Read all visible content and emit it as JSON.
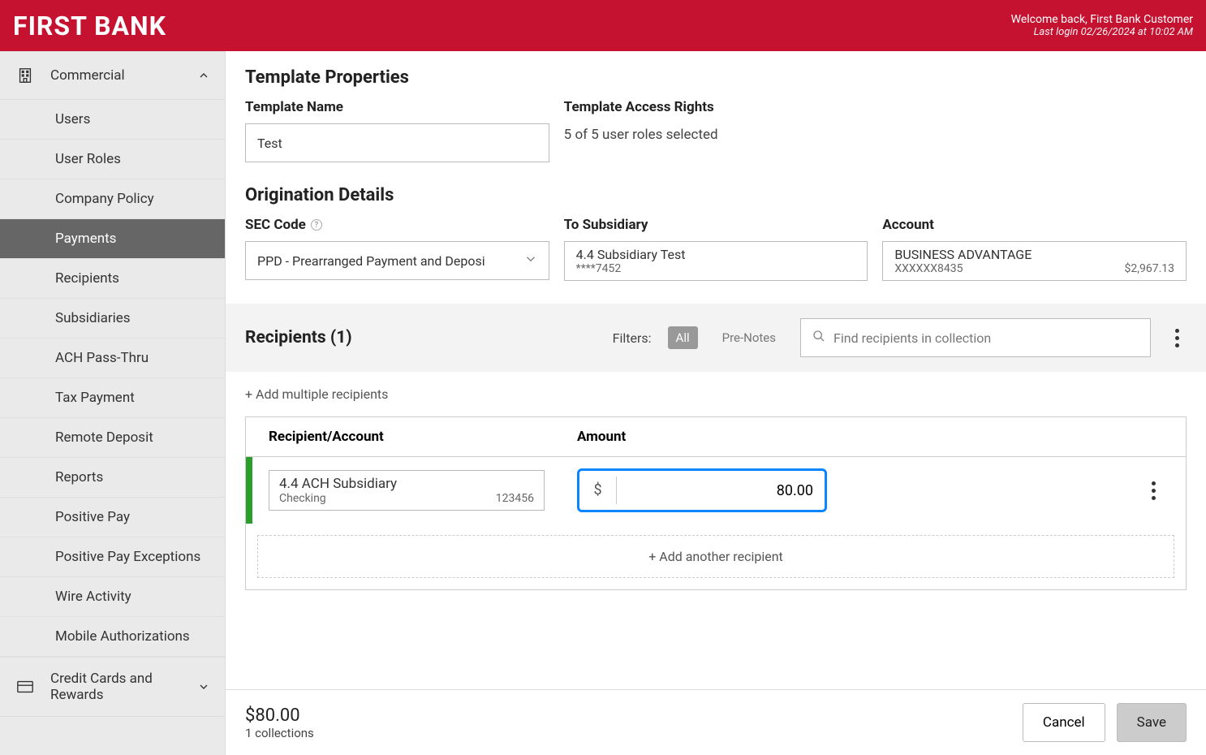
{
  "header": {
    "logo": "FIRST BANK",
    "welcome": "Welcome back, First Bank Customer",
    "last_login": "Last login 02/26/2024 at 10:02 AM"
  },
  "sidebar": {
    "group_commercial": "Commercial",
    "items": [
      "Users",
      "User Roles",
      "Company Policy",
      "Payments",
      "Recipients",
      "Subsidiaries",
      "ACH Pass-Thru",
      "Tax Payment",
      "Remote Deposit",
      "Reports",
      "Positive Pay",
      "Positive Pay Exceptions",
      "Wire Activity",
      "Mobile Authorizations"
    ],
    "group_credit": "Credit Cards and Rewards"
  },
  "template_properties": {
    "title": "Template Properties",
    "name_label": "Template Name",
    "name_value": "Test",
    "access_label": "Template Access Rights",
    "access_value": "5 of 5 user roles selected"
  },
  "origination": {
    "title": "Origination Details",
    "sec_label": "SEC Code",
    "sec_value": "PPD - Prearranged Payment and Deposi",
    "subsidiary_label": "To Subsidiary",
    "subsidiary_name": "4.4 Subsidiary Test",
    "subsidiary_acct": "****7452",
    "account_label": "Account",
    "account_name": "BUSINESS ADVANTAGE",
    "account_number": "XXXXXX8435",
    "account_balance": "$2,967.13"
  },
  "recipients": {
    "title": "Recipients (1)",
    "filters_label": "Filters:",
    "filter_all": "All",
    "filter_prenotes": "Pre-Notes",
    "search_placeholder": "Find recipients in collection",
    "add_multiple": "+ Add multiple recipients",
    "col_recipient": "Recipient/Account",
    "col_amount": "Amount",
    "row": {
      "name": "4.4 ACH Subsidiary",
      "type": "Checking",
      "number": "123456",
      "currency": "$",
      "amount": "80.00"
    },
    "add_another": "+ Add another recipient"
  },
  "footer": {
    "total": "$80.00",
    "collections": "1 collections",
    "cancel": "Cancel",
    "save": "Save"
  }
}
